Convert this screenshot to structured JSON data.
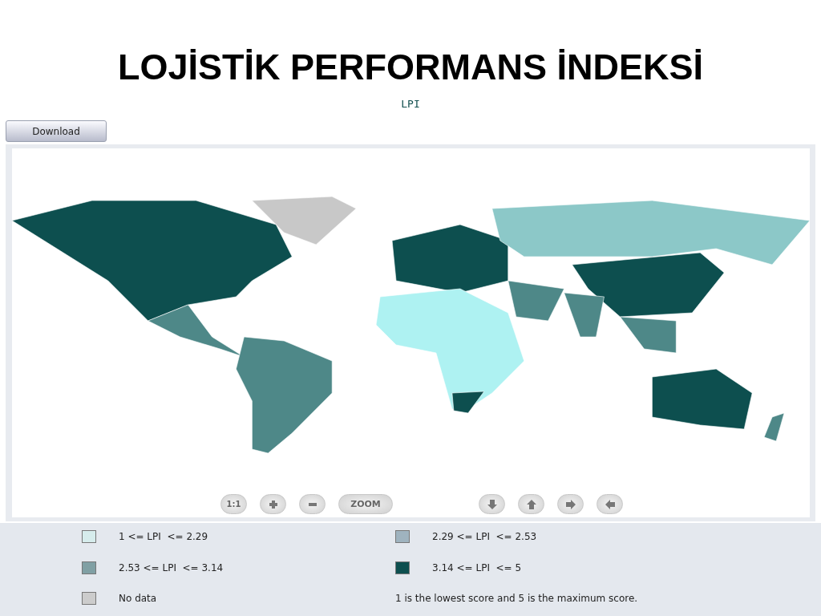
{
  "slide_title": "LOJİSTİK PERFORMANS İNDEKSİ",
  "map_title": "LPI",
  "download_button": "Download",
  "map_controls": {
    "reset_label": "1:1",
    "zoom_label": "ZOOM"
  },
  "legend": [
    {
      "label": "1 <= LPI  <= 2.29",
      "color": "#d6ecec"
    },
    {
      "label": "2.29 <= LPI  <= 2.53",
      "color": "#9fb3bf"
    },
    {
      "label": "2.53 <= LPI  <= 3.14",
      "color": "#80a0a4"
    },
    {
      "label": "3.14 <= LPI  <= 5",
      "color": "#0d4f4f"
    },
    {
      "label": "No data",
      "color": "#cccccc"
    }
  ],
  "legend_note": "1 is the lowest score and 5 is the maximum score."
}
